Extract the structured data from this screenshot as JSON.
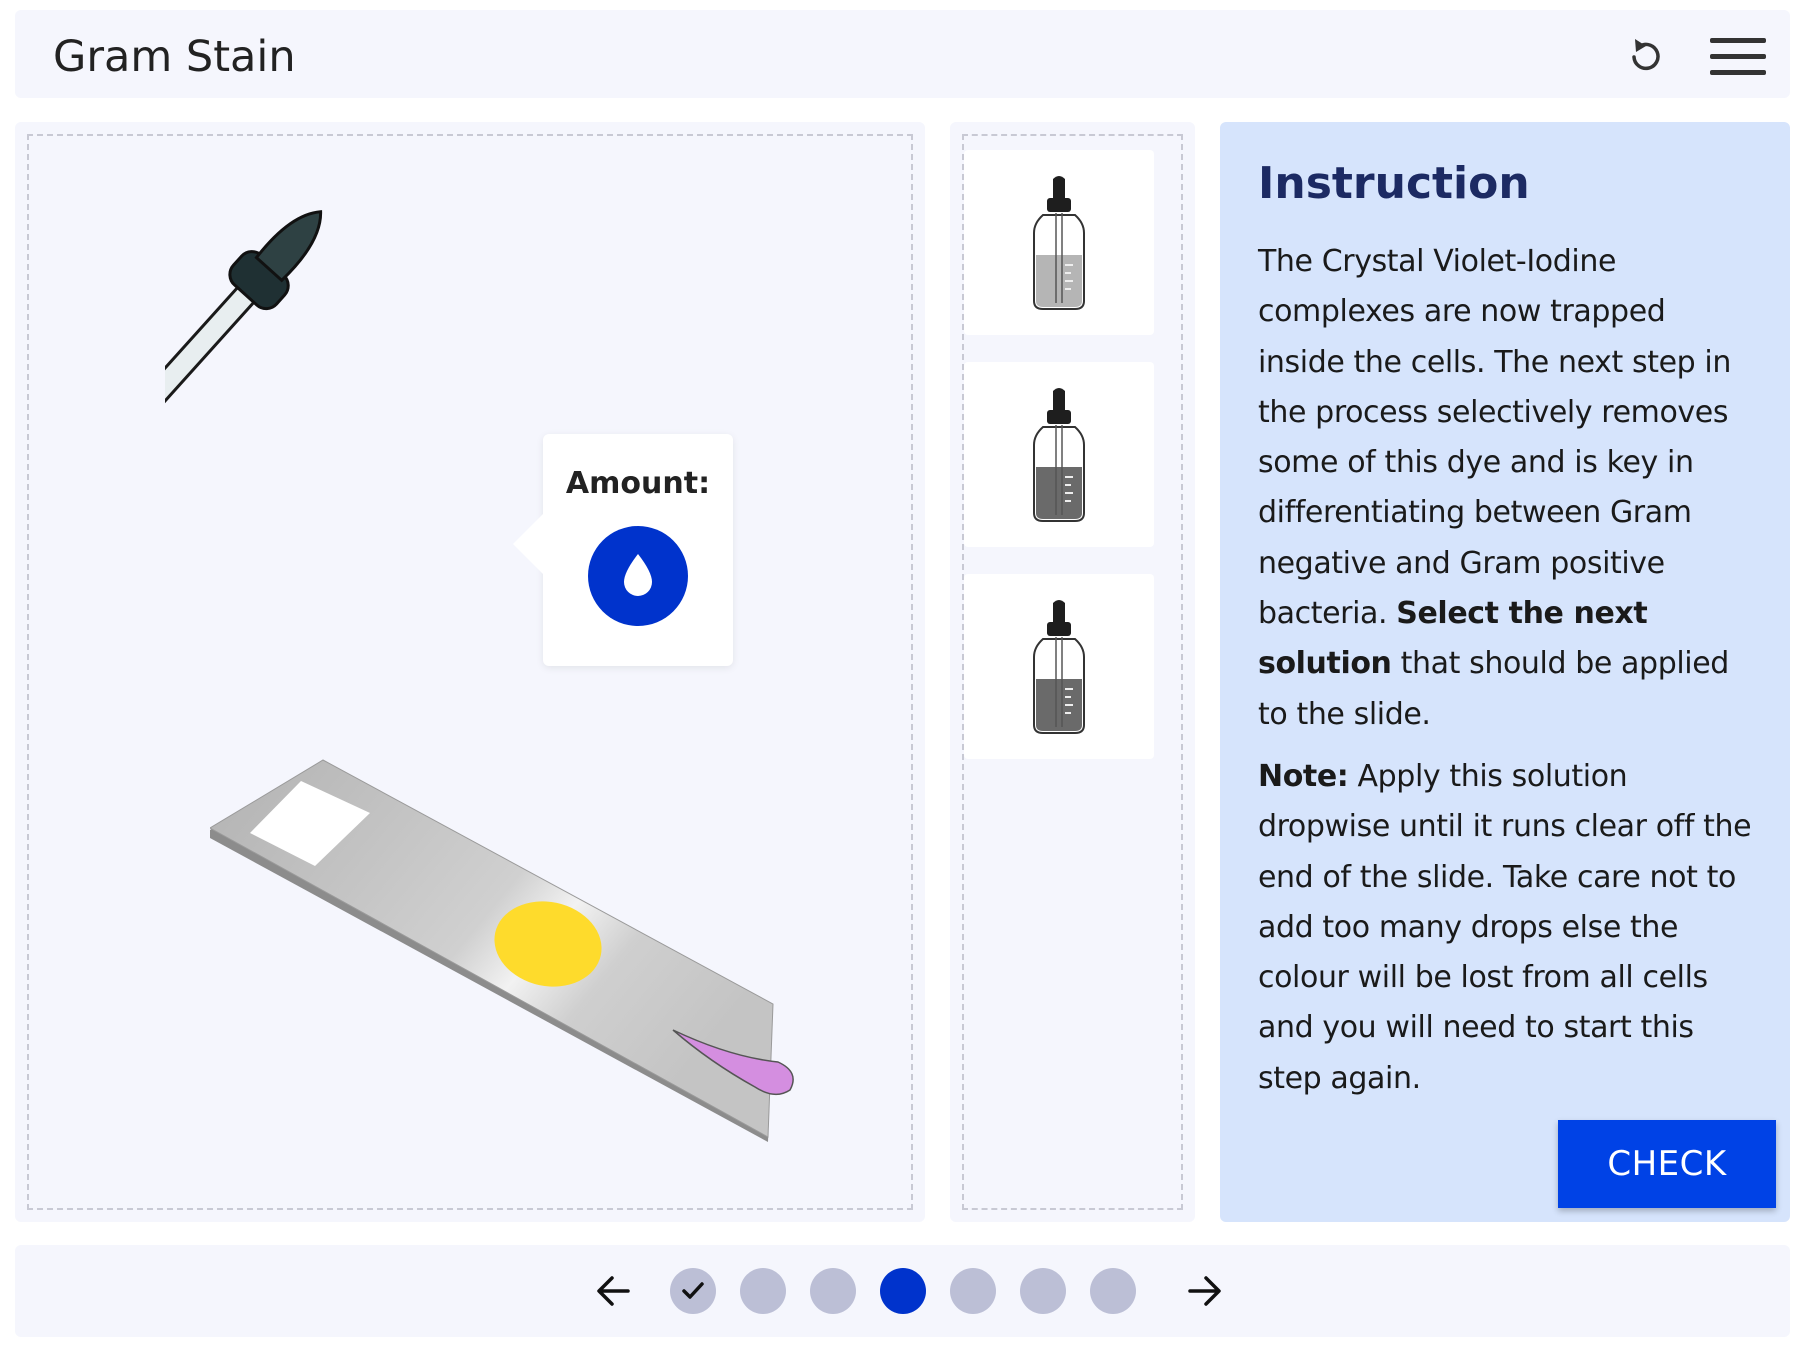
{
  "header": {
    "title": "Gram Stain"
  },
  "popup": {
    "amount_label": "Amount:"
  },
  "instruction": {
    "title": "Instruction",
    "p1_text": "The Crystal Violet-Iodine complexes are now trapped inside the cells. The next step in the process selectively removes some of this dye and is key in differentiating between Gram negative and Gram positive bacteria.",
    "p1_bold": "Select the next solution",
    "p1_tail": "that should be applied to the slide.",
    "p2_bold": "Note:",
    "p2_text": "Apply this solution dropwise until it runs clear off the end of the slide. Take care not to add too many drops else the colour will be lost from all cells and you will need to start this step again.",
    "check_label": "CHECK"
  },
  "progress": {
    "total_steps": 7,
    "current_step": 4,
    "completed_steps": [
      1
    ]
  },
  "colors": {
    "accent": "#0042e6",
    "active_dot": "#0033cc",
    "inactive_dot": "#bcbfd6",
    "panel_bg": "#f5f6fd",
    "instruction_bg": "#d6e4fc",
    "sample_spot": "#fedb2c",
    "stain_drop": "#d48ee0"
  },
  "icons": {
    "reset": "reset-icon",
    "menu": "hamburger-menu-icon",
    "prev": "arrow-left-icon",
    "next": "arrow-right-icon",
    "drop": "water-drop-icon",
    "check": "checkmark-icon"
  }
}
